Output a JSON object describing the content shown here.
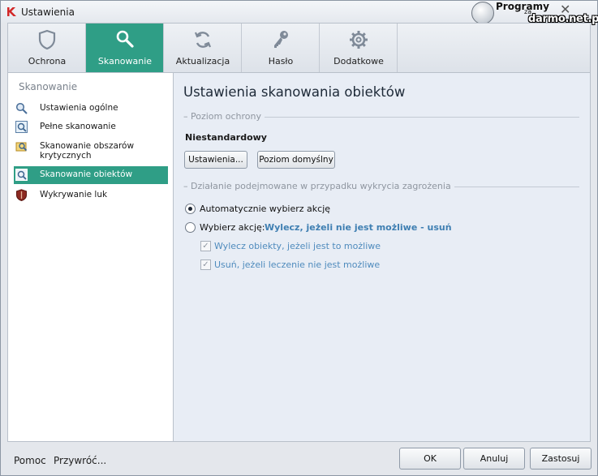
{
  "window": {
    "title": "Ustawienia",
    "close_glyph": "✕"
  },
  "watermark": {
    "line1": "Programy",
    "line2": "za",
    "line3": "darmo.net.pl"
  },
  "tabs": [
    {
      "label": "Ochrona",
      "icon": "shield-icon",
      "active": false
    },
    {
      "label": "Skanowanie",
      "icon": "magnifier-icon",
      "active": true
    },
    {
      "label": "Aktualizacja",
      "icon": "refresh-icon",
      "active": false
    },
    {
      "label": "Hasło",
      "icon": "key-icon",
      "active": false
    },
    {
      "label": "Dodatkowe",
      "icon": "gear-icon",
      "active": false
    }
  ],
  "sidebar": {
    "heading": "Skanowanie",
    "items": [
      {
        "label": "Ustawienia ogólne",
        "icon": "magnifier-icon",
        "active": false
      },
      {
        "label": "Pełne skanowanie",
        "icon": "full-scan-icon",
        "active": false
      },
      {
        "label": "Skanowanie obszarów krytycznych",
        "icon": "critical-areas-icon",
        "active": false
      },
      {
        "label": "Skanowanie obiektów",
        "icon": "object-scan-icon",
        "active": true
      },
      {
        "label": "Wykrywanie luk",
        "icon": "vulnerability-shield-icon",
        "active": false
      }
    ]
  },
  "main": {
    "title": "Ustawienia skanowania obiektów",
    "protection_section": "Poziom ochrony",
    "protection_level": "Niestandardowy",
    "settings_button": "Ustawienia...",
    "default_level_button": "Poziom domyślny",
    "action_section": "Działanie podejmowane w przypadku wykrycia zagrożenia",
    "radio_auto": "Automatycznie wybierz akcję",
    "radio_choose": "Wybierz akcję:",
    "radio_choose_value": "Wylecz, jeżeli nie jest możliwe - usuń",
    "selected_radio": "auto",
    "check_disinfect": "Wylecz obiekty, jeżeli jest to możliwe",
    "check_delete": "Usuń, jeżeli leczenie nie jest możliwe",
    "check_mark": "✓"
  },
  "footer": {
    "help": "Pomoc",
    "restore": "Przywróć...",
    "ok": "OK",
    "cancel": "Anuluj",
    "apply": "Zastosuj"
  },
  "colors": {
    "accent": "#2f9e86",
    "link": "#3f7fb2",
    "panel_bg": "#e8edf5"
  }
}
